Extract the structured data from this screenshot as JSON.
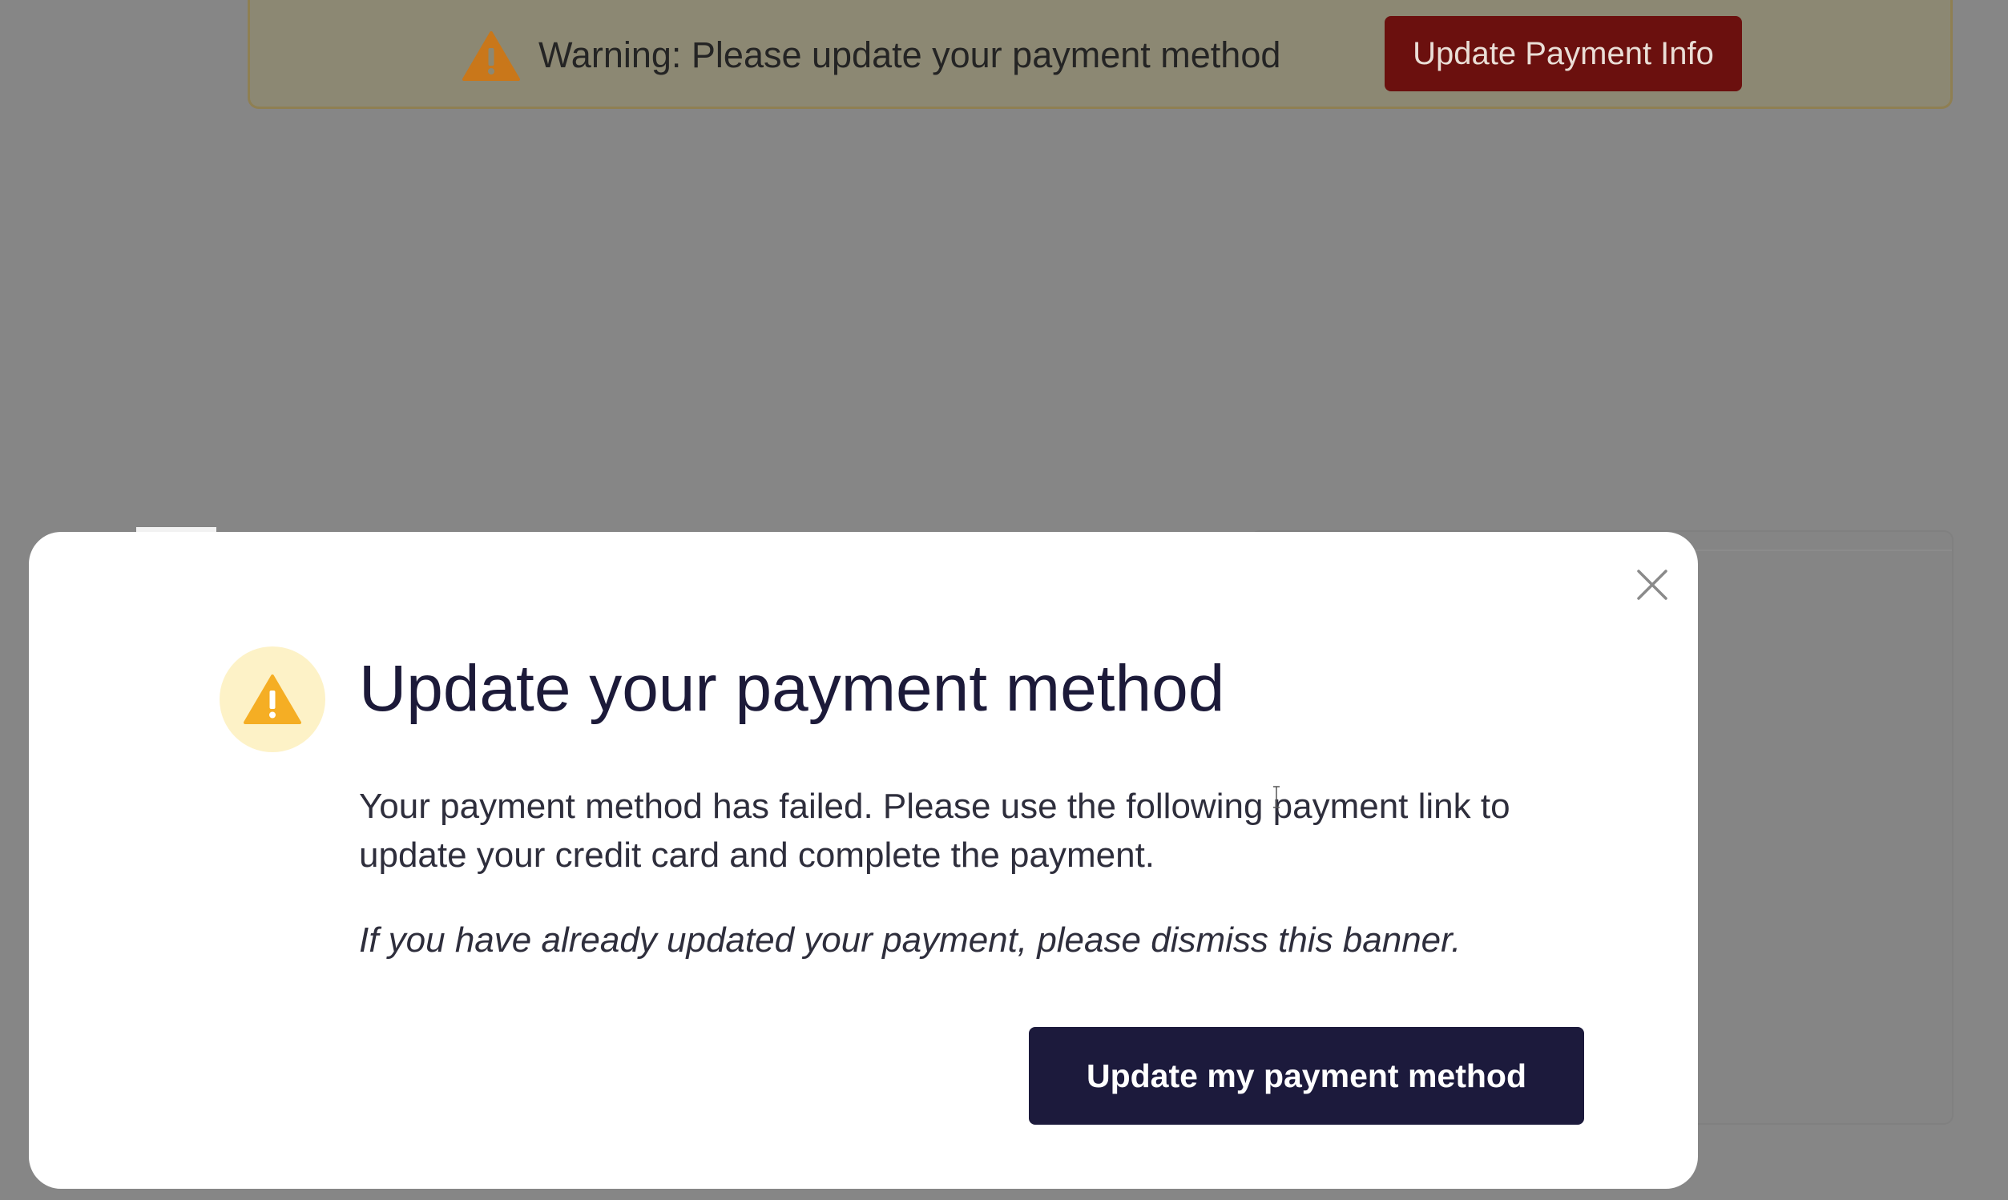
{
  "banner": {
    "icon": "warning-triangle-icon",
    "message": "Warning: Please update your payment method",
    "button_label": "Update Payment Info",
    "colors": {
      "background": "#8c8873",
      "button": "#6b100e",
      "icon": "#d07b14"
    }
  },
  "modal": {
    "close_icon": "close-icon",
    "title_icon": "warning-triangle-icon",
    "title": "Update your payment method",
    "body": "Your payment method has failed. Please use the following payment link to update your credit card and complete the payment.",
    "note": "If you have already updated your payment, please dismiss this banner.",
    "primary_button_label": "Update my payment method",
    "colors": {
      "title": "#1c1a39",
      "button": "#1c1a3c",
      "icon_circle": "#fdf2c7",
      "icon": "#f5ae24"
    }
  },
  "overlay": {
    "color": "#868686"
  }
}
